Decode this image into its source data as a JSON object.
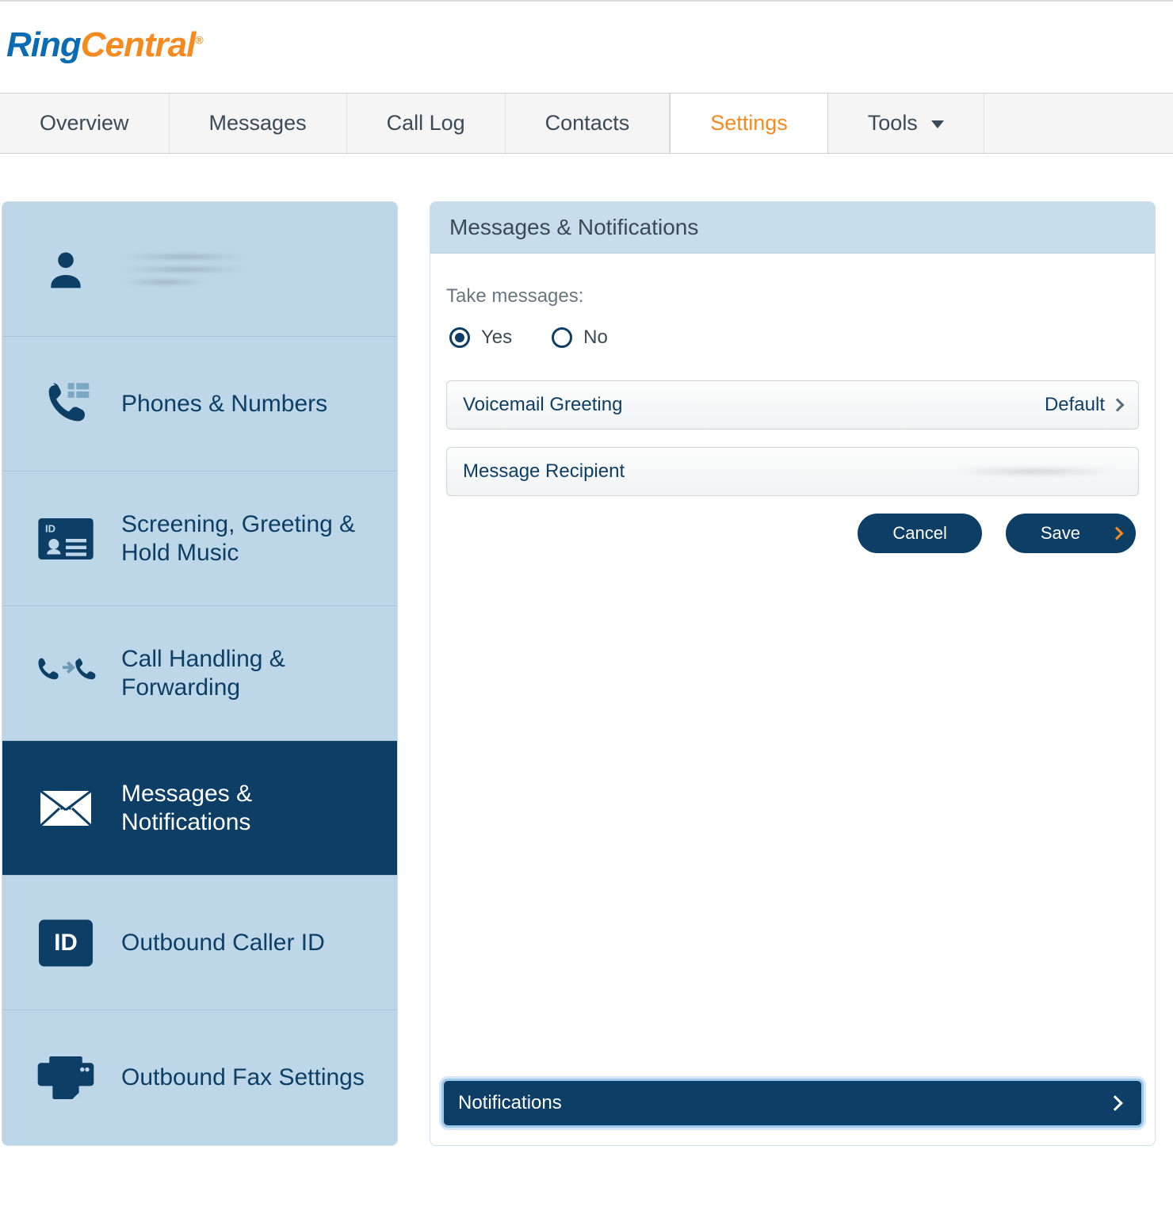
{
  "brand": {
    "part1": "Ring",
    "part2": "Central"
  },
  "tabs": {
    "overview": "Overview",
    "messages": "Messages",
    "calllog": "Call Log",
    "contacts": "Contacts",
    "settings": "Settings",
    "tools": "Tools"
  },
  "sidebar": {
    "phones": "Phones & Numbers",
    "screening": "Screening, Greeting & Hold Music",
    "callhandling": "Call Handling & Forwarding",
    "messages": "Messages & Notifications",
    "callerid": "Outbound Caller ID",
    "fax": "Outbound Fax Settings"
  },
  "panel": {
    "title": "Messages & Notifications",
    "take_messages_label": "Take messages:",
    "yes": "Yes",
    "no": "No",
    "voicemail_greeting": "Voicemail Greeting",
    "voicemail_greeting_value": "Default",
    "message_recipient": "Message Recipient",
    "cancel": "Cancel",
    "save": "Save",
    "notifications": "Notifications"
  }
}
